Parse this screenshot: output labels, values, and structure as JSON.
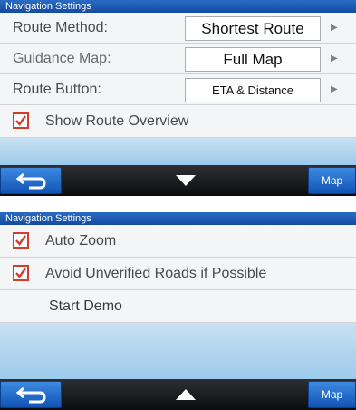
{
  "screen1": {
    "title": "Navigation Settings",
    "rows": [
      {
        "label": "Route Method:",
        "value": "Shortest Route"
      },
      {
        "label": "Guidance Map:",
        "value": "Full Map"
      },
      {
        "label": "Route Button:",
        "value": "ETA & Distance"
      }
    ],
    "checkbox": {
      "label": "Show Route Overview",
      "checked": true
    },
    "bottombar": {
      "map_label": "Map",
      "scroll_direction": "down"
    }
  },
  "screen2": {
    "title": "Navigation Settings",
    "checkboxes": [
      {
        "label": "Auto Zoom",
        "checked": true
      },
      {
        "label": "Avoid Unverified Roads if Possible",
        "checked": true
      }
    ],
    "plain_item": "Start Demo",
    "bottombar": {
      "map_label": "Map",
      "scroll_direction": "up"
    }
  },
  "icons": {
    "back": "back-arrow-icon",
    "scroll_down": "triangle-down-icon",
    "scroll_up": "triangle-up-icon",
    "row_arrow": "triangle-right-icon",
    "check": "checkmark-icon"
  },
  "colors": {
    "title_bar": "#1c58b0",
    "button_blue": "#2a6fd0",
    "checkbox_red": "#d23c2b",
    "row_bg": "#f4f5f6"
  }
}
